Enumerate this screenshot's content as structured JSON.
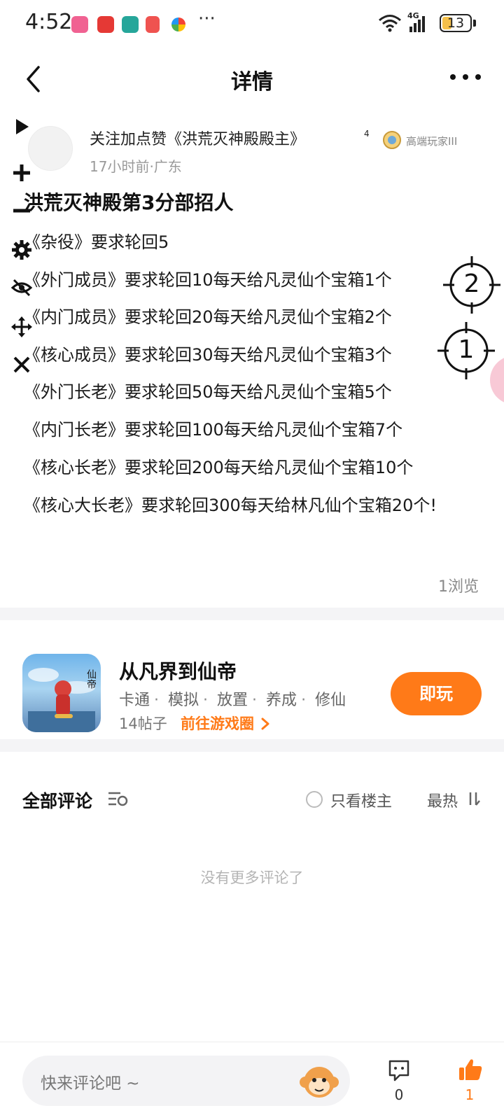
{
  "status_bar": {
    "time": "4:52",
    "more": "···",
    "network": "4G",
    "battery": "13"
  },
  "header": {
    "title": "详情"
  },
  "post": {
    "author": "关注加点赞《洪荒灭神殿殿主》",
    "author_suffix": "4",
    "badge": "高端玩家III",
    "meta": "17小时前·广东",
    "title": "洪荒灭神殿第3分部招人",
    "lines": [
      "《杂役》要求轮回5",
      "《外门成员》要求轮回10每天给凡灵仙个宝箱1个",
      "《内门成员》要求轮回20每天给凡灵仙个宝箱2个",
      "《核心成员》要求轮回30每天给凡灵仙个宝箱3个",
      "《外门长老》要求轮回50每天给凡灵仙个宝箱5个",
      "《内门长老》要求轮回100每天给凡灵仙个宝箱7个",
      "《核心长老》要求轮回200每天给凡灵仙个宝箱10个"
    ],
    "last_line": "《核心大长老》要求轮回300每天给林凡仙个宝箱20个!",
    "views": "1浏览"
  },
  "game": {
    "name": "从凡界到仙帝",
    "icon_text": "仙帝",
    "tags": [
      "卡通",
      "模拟",
      "放置",
      "养成",
      "修仙"
    ],
    "posts": "14帖子",
    "link": "前往游戏圈",
    "play": "即玩"
  },
  "comments": {
    "title": "全部评论",
    "only_op": "只看楼主",
    "sort": "最热",
    "empty": "没有更多评论了"
  },
  "bottom": {
    "placeholder": "快来评论吧 ~",
    "comment_count": "0",
    "like_count": "1"
  },
  "overlay": {
    "marker_2": "2",
    "marker_1": "1"
  },
  "colors": {
    "accent": "#ff7a18",
    "text": "#1a1a1a",
    "muted": "#9a9a9a"
  }
}
